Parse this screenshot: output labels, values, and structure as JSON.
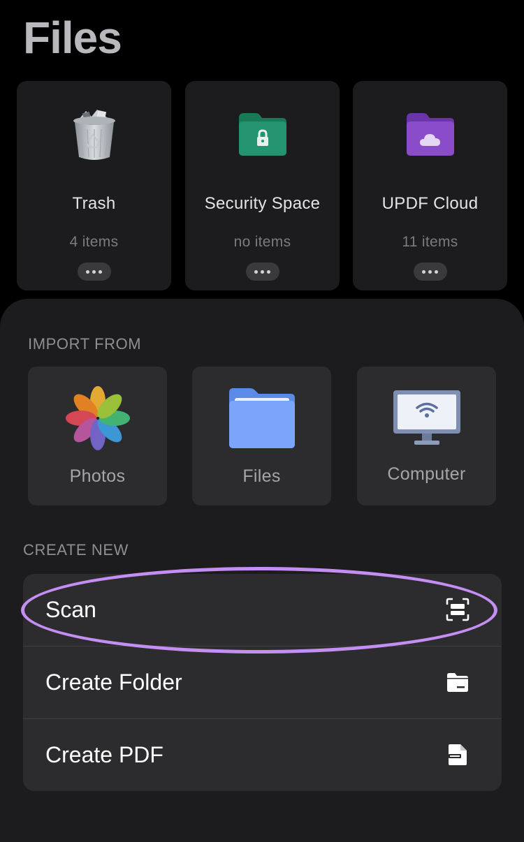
{
  "header": {
    "title": "Files"
  },
  "storage_cards": [
    {
      "title": "Trash",
      "subtitle": "4 items",
      "icon": "trash-icon"
    },
    {
      "title": "Security Space",
      "subtitle": "no items",
      "icon": "lock-folder-icon",
      "color": "#1f8a64"
    },
    {
      "title": "UPDF Cloud",
      "subtitle": "11 items",
      "icon": "cloud-folder-icon",
      "color": "#8a4cc8"
    }
  ],
  "import": {
    "label": "IMPORT FROM",
    "sources": [
      {
        "label": "Photos",
        "icon": "photos-icon"
      },
      {
        "label": "Files",
        "icon": "files-folder-icon",
        "color": "#6e9ef7"
      },
      {
        "label": "Computer",
        "icon": "computer-wifi-icon"
      }
    ]
  },
  "create": {
    "label": "CREATE NEW",
    "items": [
      {
        "label": "Scan",
        "icon": "scan-icon"
      },
      {
        "label": "Create Folder",
        "icon": "folder-icon"
      },
      {
        "label": "Create PDF",
        "icon": "pdf-file-icon"
      }
    ]
  },
  "highlight_color": "#c48ef2"
}
